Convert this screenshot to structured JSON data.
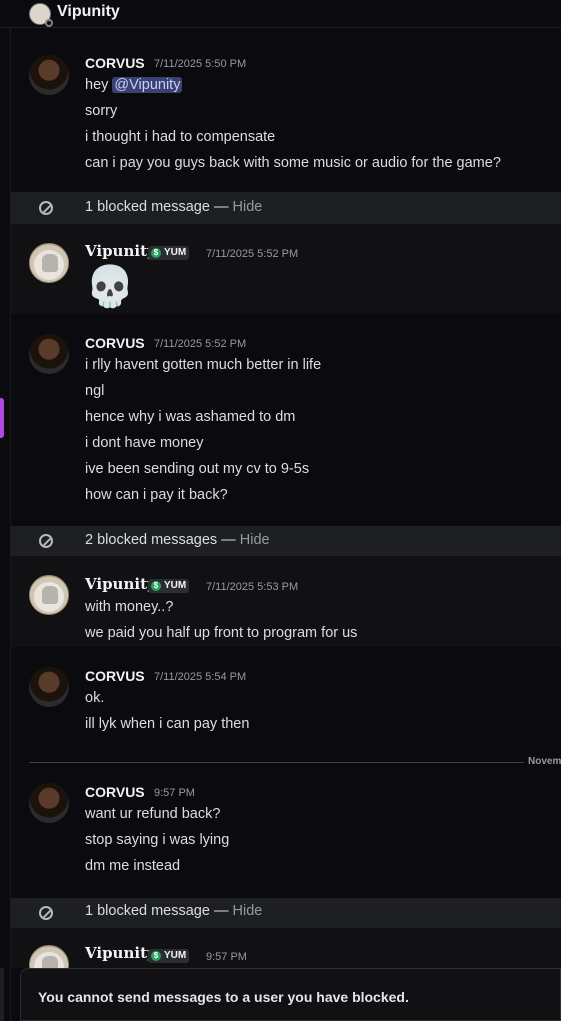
{
  "header": {
    "title": "Vipunity",
    "channel_icon": "user-avatar-icon"
  },
  "messages": [
    {
      "author": "CORVUS",
      "time": "7/11/2025 5:50 PM",
      "lines": [
        "hey",
        "sorry",
        "i thought i had to compensate",
        "can i pay you guys back with some music or audio for the game?"
      ],
      "mention": "@Vipunity"
    },
    {
      "blocked": "1 blocked message",
      "sep": " — ",
      "hide": "Hide"
    },
    {
      "author": "Vipunity",
      "tag": "YUM",
      "time": "7/11/2025 5:52 PM",
      "emoji": "💀"
    },
    {
      "author": "CORVUS",
      "time": "7/11/2025 5:52 PM",
      "lines": [
        "i rlly havent gotten much better in life",
        "ngl",
        "hence why i was ashamed to dm",
        "i dont have money",
        "ive been sending out my cv to 9-5s",
        "how can i pay it back?"
      ]
    },
    {
      "blocked": "2 blocked messages",
      "sep": " — ",
      "hide": "Hide"
    },
    {
      "author": "Vipunity",
      "tag": "YUM",
      "time": "7/11/2025 5:53 PM",
      "lines": [
        "with money..?",
        "we paid you half up front to program for us"
      ]
    },
    {
      "author": "CORVUS",
      "time": "7/11/2025 5:54 PM",
      "lines": [
        "ok.",
        "ill lyk when i can pay then"
      ]
    },
    {
      "author": "CORVUS",
      "time": "9:57 PM",
      "lines": [
        "want ur refund back?",
        "stop saying i was lying",
        "dm me instead"
      ]
    },
    {
      "blocked": "1 blocked message",
      "sep": " — ",
      "hide": "Hide"
    },
    {
      "author": "Vipunity",
      "tag": "YUM",
      "time": "9:57 PM"
    }
  ],
  "date_divider": "Novem",
  "composer_notice": "You cannot send messages to a user you have blocked.",
  "colors": {
    "mention_bg": "#3c4270",
    "blocked_bg": "#1e1f22",
    "tag_icon": "#23a55a"
  }
}
